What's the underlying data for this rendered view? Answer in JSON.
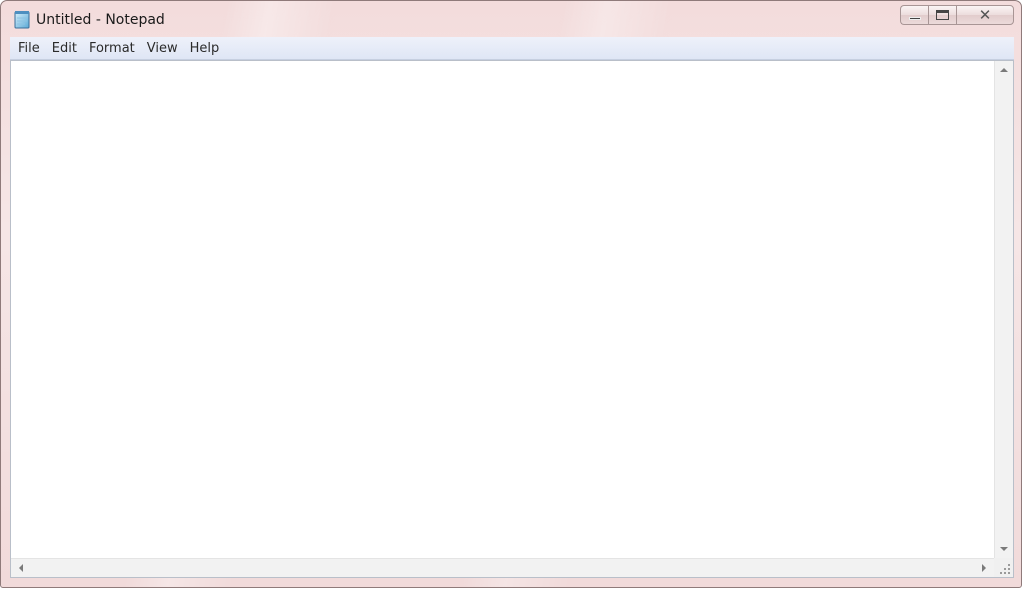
{
  "window": {
    "title": "Untitled - Notepad",
    "app_icon": "notepad-icon"
  },
  "caption_buttons": {
    "minimize_icon": "minimize-icon",
    "maximize_icon": "maximize-icon",
    "close_glyph": "✕"
  },
  "menu": {
    "items": [
      {
        "label": "File"
      },
      {
        "label": "Edit"
      },
      {
        "label": "Format"
      },
      {
        "label": "View"
      },
      {
        "label": "Help"
      }
    ]
  },
  "editor": {
    "content": ""
  },
  "colors": {
    "frame": "#f3dcdc",
    "menubar": "#dfe6f5",
    "editor_bg": "#ffffff"
  }
}
